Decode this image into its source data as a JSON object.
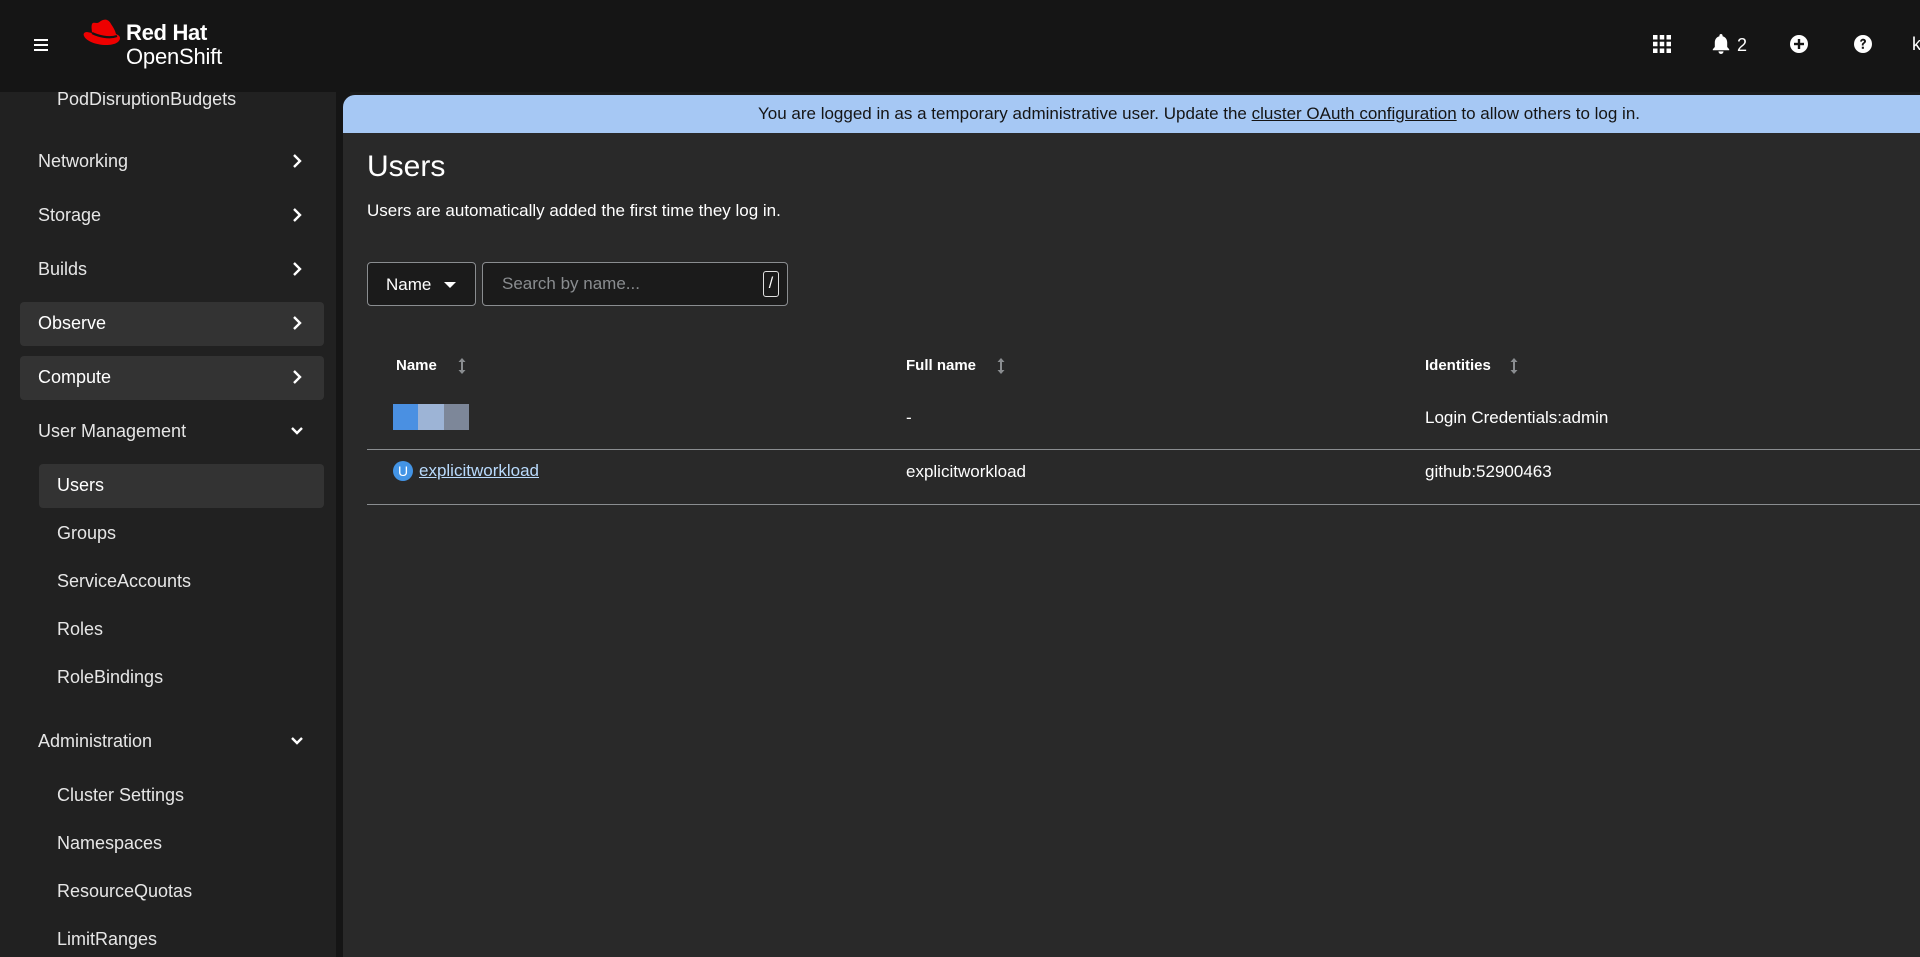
{
  "masthead": {
    "brand_line1": "Red Hat",
    "brand_line2": "OpenShift",
    "notification_count": "2",
    "user_initial": "k",
    "icons": [
      "menu-icon",
      "grid-icon",
      "bell-icon",
      "plus-circle-icon",
      "question-circle-icon"
    ]
  },
  "sidebar": {
    "top_item": "PodDisruptionBudgets",
    "sections": [
      {
        "label": "Networking",
        "expanded": false
      },
      {
        "label": "Storage",
        "expanded": false
      },
      {
        "label": "Builds",
        "expanded": false
      },
      {
        "label": "Observe",
        "expanded": false
      },
      {
        "label": "Compute",
        "expanded": false
      },
      {
        "label": "User Management",
        "expanded": true
      },
      {
        "label": "Administration",
        "expanded": true
      }
    ],
    "user_management_items": [
      "Users",
      "Groups",
      "ServiceAccounts",
      "Roles",
      "RoleBindings"
    ],
    "administration_items": [
      "Cluster Settings",
      "Namespaces",
      "ResourceQuotas",
      "LimitRanges"
    ]
  },
  "banner": {
    "prefix": "You are logged in as a temporary administrative user. Update the ",
    "link": "cluster OAuth configuration",
    "suffix": " to allow others to log in."
  },
  "page": {
    "title": "Users",
    "description": "Users are automatically added the first time they log in."
  },
  "filter": {
    "selected": "Name",
    "placeholder": "Search by name...",
    "shortcut": "/"
  },
  "table": {
    "columns": [
      "Name",
      "Full name",
      "Identities"
    ],
    "rows": [
      {
        "name": "",
        "badge": "",
        "full_name": "-",
        "identities": "Login Credentials:admin",
        "redacted": true
      },
      {
        "name": "explicitworkload",
        "badge": "U",
        "full_name": "explicitworkload",
        "identities": "github:52900463",
        "redacted": false
      }
    ]
  },
  "colors": {
    "banner_bg": "#a6c8f4",
    "link": "#b9dafc",
    "badge": "#4394e5",
    "brand_red": "#ee0000",
    "redacted": [
      "#4a90e2",
      "#9db4d6",
      "#7d8799"
    ]
  }
}
